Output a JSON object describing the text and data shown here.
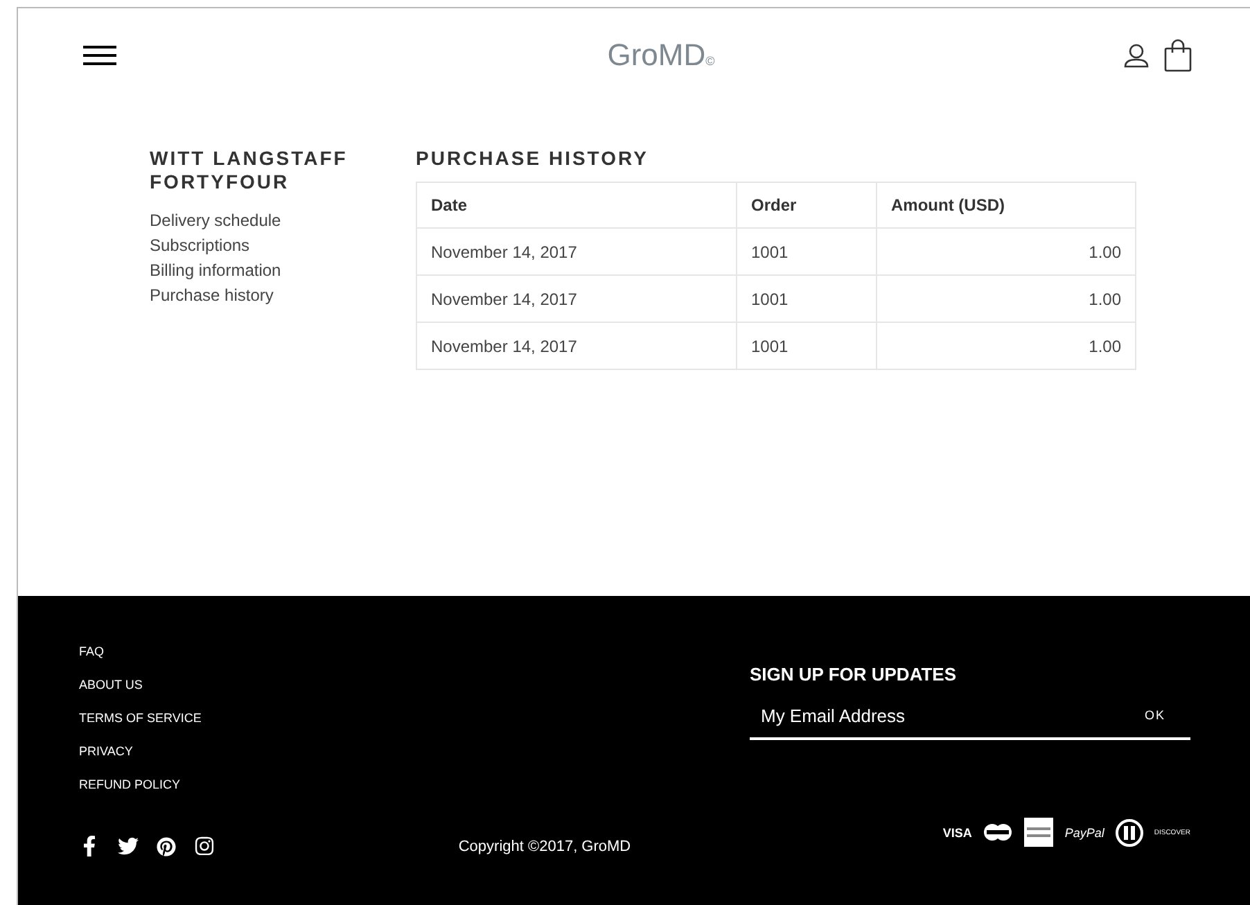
{
  "header": {
    "logo": "GroMD",
    "logo_mark": "©"
  },
  "sidebar": {
    "title": "WITT LANGSTAFF FORTYFOUR",
    "items": [
      "Delivery schedule",
      "Subscriptions",
      "Billing information",
      "Purchase history"
    ]
  },
  "main": {
    "title": "PURCHASE HISTORY",
    "table": {
      "columns": [
        "Date",
        "Order",
        "Amount (USD)"
      ],
      "rows": [
        [
          "November 14, 2017",
          "1001",
          "1.00"
        ],
        [
          "November 14, 2017",
          "1001",
          "1.00"
        ],
        [
          "November 14, 2017",
          "1001",
          "1.00"
        ]
      ]
    }
  },
  "footer": {
    "links": [
      "FAQ",
      "ABOUT US",
      "TERMS OF SERVICE",
      "PRIVACY",
      "REFUND POLICY"
    ],
    "social": [
      {
        "kind": "facebook"
      },
      {
        "kind": "twitter"
      },
      {
        "kind": "pinterest"
      },
      {
        "kind": "instagram"
      }
    ],
    "copyright": "Copyright ©2017, GroMD",
    "signup": {
      "title": "SIGN UP FOR UPDATES",
      "placeholder": "My Email Address",
      "button": "OK"
    },
    "payments": [
      {
        "kind": "visa",
        "label": "VISA"
      },
      {
        "kind": "mastercard"
      },
      {
        "kind": "amex"
      },
      {
        "kind": "paypal",
        "label": "PayPal"
      },
      {
        "kind": "diners"
      },
      {
        "kind": "discover",
        "label": "DISCOVER"
      }
    ]
  }
}
